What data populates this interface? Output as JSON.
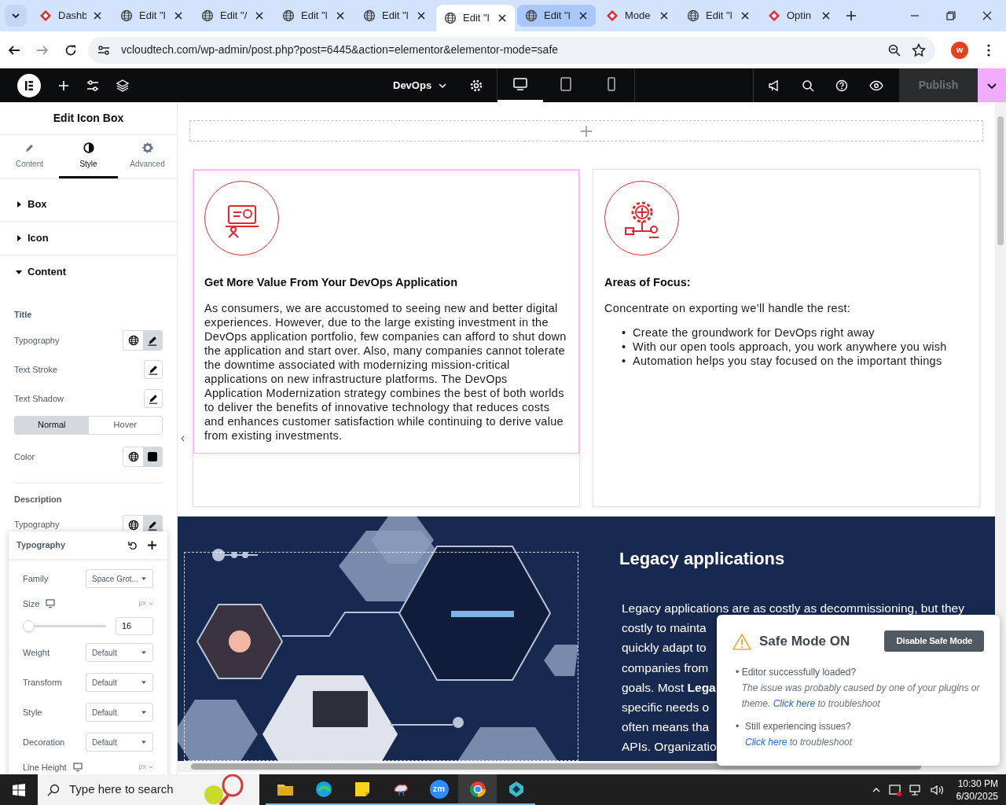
{
  "browser": {
    "tabs": [
      {
        "title": "Dashb",
        "kind": "diamond",
        "selected": false,
        "highlighted": false
      },
      {
        "title": "Edit \"l",
        "kind": "globe",
        "selected": false,
        "highlighted": false
      },
      {
        "title": "Edit \"/",
        "kind": "globe",
        "selected": false,
        "highlighted": false
      },
      {
        "title": "Edit \"l",
        "kind": "globe",
        "selected": false,
        "highlighted": false
      },
      {
        "title": "Edit \"l",
        "kind": "globe",
        "selected": false,
        "highlighted": false
      },
      {
        "title": "Edit \"l",
        "kind": "globe",
        "selected": true,
        "highlighted": false
      },
      {
        "title": "Edit \"l",
        "kind": "globe",
        "selected": false,
        "highlighted": true
      },
      {
        "title": "Mode",
        "kind": "diamond",
        "selected": false,
        "highlighted": false
      },
      {
        "title": "Edit \"l",
        "kind": "globe",
        "selected": false,
        "highlighted": false
      },
      {
        "title": "Optin",
        "kind": "diamond",
        "selected": false,
        "highlighted": false
      }
    ],
    "address": "vcloudtech.com/wp-admin/post.php?post=6445&action=elementor&elementor-mode=safe",
    "profile_initial": "w"
  },
  "editor_bar": {
    "page_name": "DevOps",
    "devices": [
      {
        "kind": "desktop",
        "selected": true
      },
      {
        "kind": "tablet",
        "selected": false
      },
      {
        "kind": "mobile",
        "selected": false
      }
    ],
    "publish": {
      "label": "Publish",
      "disabled": true
    }
  },
  "panel": {
    "title": "Edit Icon Box",
    "tabs": [
      {
        "label": "Content",
        "kind": "pencil",
        "selected": false
      },
      {
        "label": "Style",
        "kind": "contrast",
        "selected": true
      },
      {
        "label": "Advanced",
        "kind": "gear",
        "selected": false
      }
    ],
    "sections": [
      {
        "label": "Box",
        "expanded": false
      },
      {
        "label": "Icon",
        "expanded": false
      },
      {
        "label": "Content",
        "expanded": true
      }
    ],
    "controls": [
      {
        "kind": "heading",
        "label": "Title"
      },
      {
        "kind": "typography",
        "label": "Typography"
      },
      {
        "kind": "edit",
        "label": "Text Stroke"
      },
      {
        "kind": "edit",
        "label": "Text Shadow"
      },
      {
        "kind": "toggle",
        "options": [
          {
            "label": "Normal",
            "selected": true
          },
          {
            "label": "Hover",
            "selected": false
          }
        ]
      },
      {
        "kind": "color",
        "label": "Color",
        "color": "#000000"
      },
      {
        "kind": "heading",
        "label": "Description"
      },
      {
        "kind": "typography",
        "label": "Typography"
      }
    ],
    "popover": {
      "title": "Typography",
      "fields": [
        {
          "kind": "select",
          "label": "Family",
          "value": "Space Grot..."
        },
        {
          "kind": "slider",
          "label": "Size",
          "unit": "px",
          "level": 0,
          "value": "16"
        },
        {
          "kind": "select",
          "label": "Weight",
          "value": "Default"
        },
        {
          "kind": "select",
          "label": "Transform",
          "value": "Default"
        },
        {
          "kind": "select",
          "label": "Style",
          "value": "Default"
        },
        {
          "kind": "select",
          "label": "Decoration",
          "value": "Default"
        },
        {
          "kind": "unit",
          "label": "Line Height",
          "unit": "px"
        }
      ]
    }
  },
  "canvas": {
    "cards": [
      {
        "kind": "laptop",
        "selected": true,
        "title": "Get More Value From Your DevOps Application",
        "description": "As consumers, we are accustomed to seeing new and better digital experiences. However, due to the large existing investment in the DevOps application portfolio, few companies can afford to shut down the application and start over. Also, many companies cannot tolerate the downtime associated with modernizing mission-critical applications on new infrastructure platforms. The DevOps Application Modernization strategy combines the best of both worlds to deliver the benefits of innovative technology that reduces costs and enhances customer satisfaction while continuing to derive value from existing investments."
      },
      {
        "kind": "gear",
        "selected": false,
        "bullet_marker": "•",
        "title": "Areas of Focus:",
        "description": "Concentrate on exporting we’ll handle the rest:",
        "bullets": [
          "Create the groundwork for DevOps right away",
          "With our open tools approach, you work anywhere you wish",
          "Automation helps you stay focused on the important things"
        ]
      }
    ],
    "legacy": {
      "heading": "Legacy applications",
      "lines": [
        "Legacy applications are as costly as decommissioning, but they",
        "costly to mainta",
        "quickly adapt to",
        "companies from",
        "goals. Most **Lega**",
        "specific needs o",
        "often means tha",
        "APIs. Organizatio"
      ]
    }
  },
  "safe_mode": {
    "bullet_marker": "•",
    "title": "Safe Mode ON",
    "button": "Disable Safe Mode",
    "items": [
      {
        "question": "Editor successfully loaded?",
        "note": "The issue was probably caused by one of your plugins or theme.",
        "link": "Click here",
        "after": "to troubleshoot"
      },
      {
        "question": "Still experiencing issues?",
        "link": "Click here",
        "after": "to troubleshoot"
      }
    ]
  },
  "taskbar": {
    "search_placeholder": "Type here to search",
    "apps": [
      {
        "kind": "folder",
        "selected": false
      },
      {
        "kind": "swirl",
        "selected": false
      },
      {
        "kind": "note",
        "selected": false
      },
      {
        "kind": "cloud",
        "selected": false
      },
      {
        "kind": "zoom",
        "label": "zm",
        "selected": false
      },
      {
        "kind": "chrome",
        "selected": true
      },
      {
        "kind": "diamond",
        "selected": false
      }
    ],
    "time": "10:30 PM",
    "date": "6/30/2025"
  }
}
